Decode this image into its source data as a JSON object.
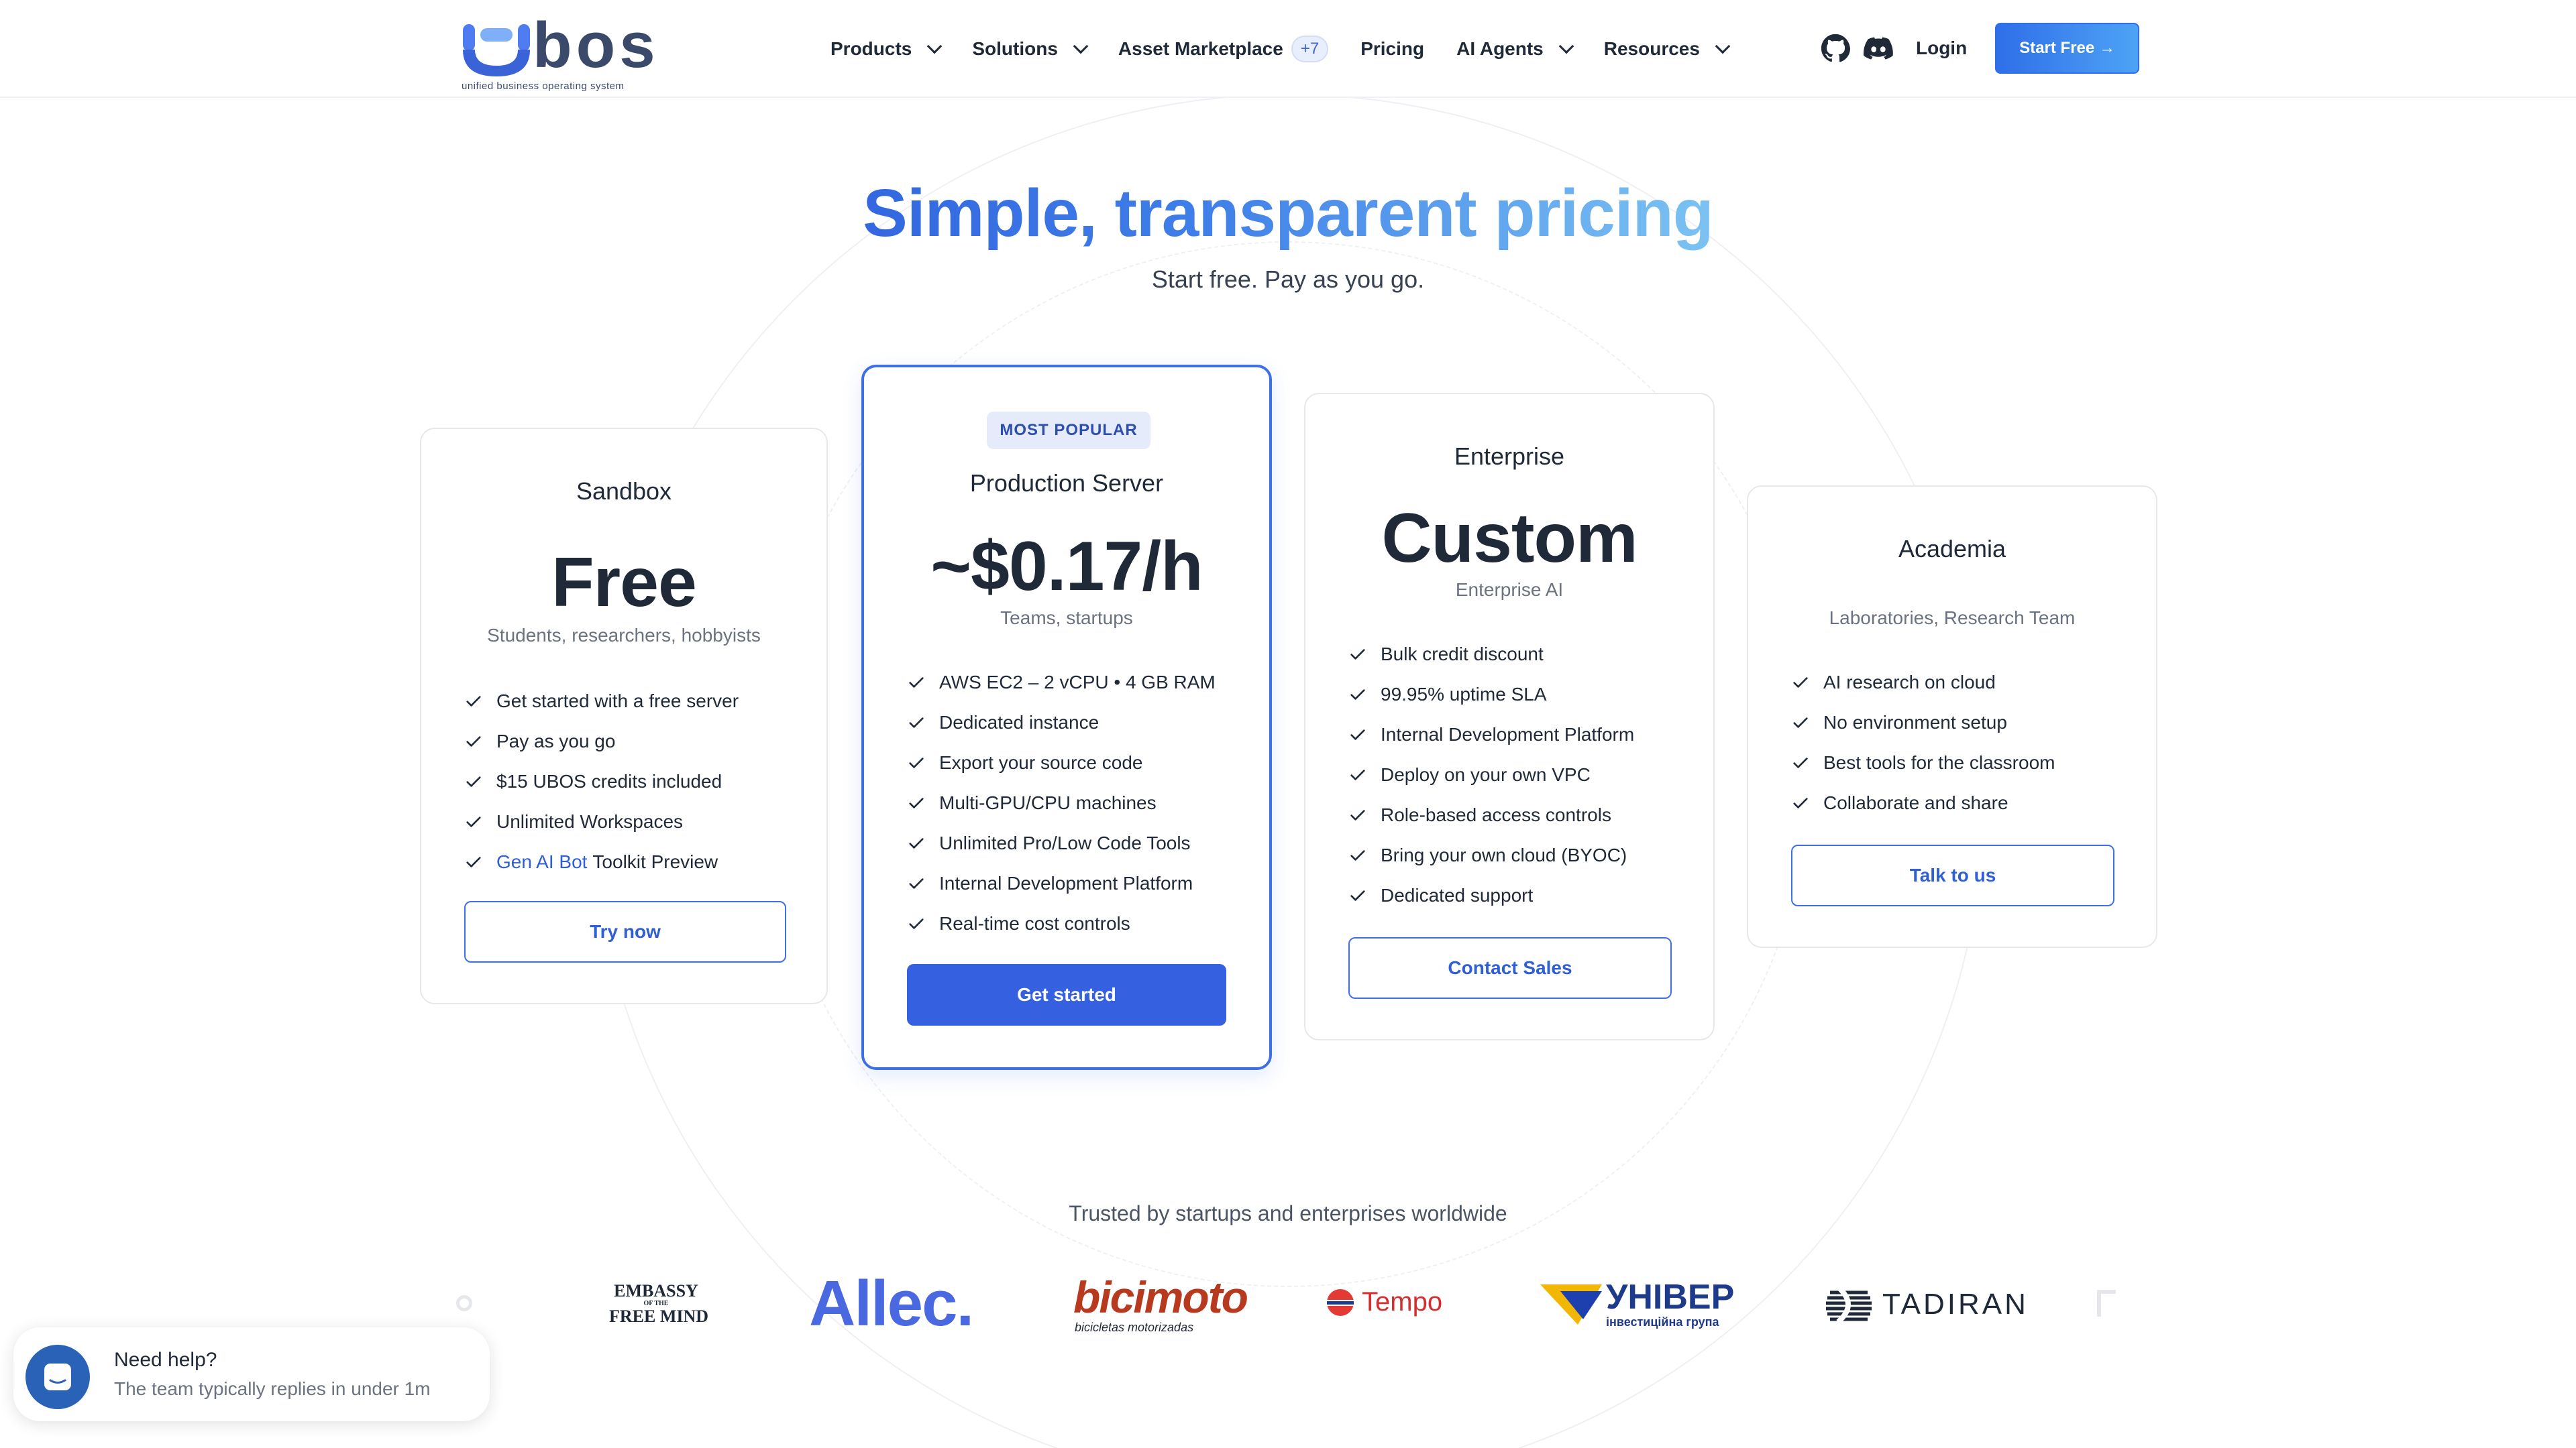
{
  "nav": {
    "logo_text": "ubos",
    "logo_tagline": "unified business operating system",
    "items": [
      {
        "label": "Products",
        "has_dropdown": true
      },
      {
        "label": "Solutions",
        "has_dropdown": true
      },
      {
        "label": "Asset Marketplace",
        "badge": "+7"
      },
      {
        "label": "Pricing"
      },
      {
        "label": "AI Agents",
        "has_dropdown": true
      },
      {
        "label": "Resources",
        "has_dropdown": true
      }
    ],
    "github_icon": "github-icon",
    "discord_icon": "discord-icon",
    "login": "Login",
    "cta": "Start Free →"
  },
  "hero": {
    "title": "Simple, transparent pricing",
    "subtitle": "Start free. Pay as you go."
  },
  "plans": [
    {
      "name": "Sandbox",
      "price": "Free",
      "audience": "Students, researchers, hobbyists",
      "features": [
        {
          "text": "Get started with a free server"
        },
        {
          "text": "Pay as you go"
        },
        {
          "text": "$15 UBOS credits included"
        },
        {
          "text": "Unlimited Workspaces"
        },
        {
          "link": "Gen AI Bot",
          "text": "Toolkit Preview"
        }
      ],
      "cta": "Try now"
    },
    {
      "badge": "MOST POPULAR",
      "name": "Production Server",
      "price": "~$0.17/h",
      "audience": "Teams, startups",
      "features": [
        {
          "text": "AWS EC2 – 2 vCPU • 4 GB RAM"
        },
        {
          "text": "Dedicated instance"
        },
        {
          "text": "Export your source code"
        },
        {
          "text": "Multi-GPU/CPU machines"
        },
        {
          "text": "Unlimited Pro/Low Code Tools"
        },
        {
          "text": "Internal Development Platform"
        },
        {
          "text": "Real-time cost controls"
        }
      ],
      "cta": "Get started"
    },
    {
      "name": "Enterprise",
      "price": "Custom",
      "audience": "Enterprise AI",
      "features": [
        {
          "text": "Bulk credit discount"
        },
        {
          "text": "99.95% uptime SLA"
        },
        {
          "text": "Internal Development Platform"
        },
        {
          "text": "Deploy on your own VPC"
        },
        {
          "text": "Role-based access controls"
        },
        {
          "text": "Bring your own cloud (BYOC)"
        },
        {
          "text": "Dedicated support"
        }
      ],
      "cta": "Contact Sales"
    },
    {
      "name": "Academia",
      "audience": "Laboratories, Research Team",
      "features": [
        {
          "text": "AI research on cloud"
        },
        {
          "text": "No environment setup"
        },
        {
          "text": "Best tools for the classroom"
        },
        {
          "text": "Collaborate and share"
        }
      ],
      "cta": "Talk to us"
    }
  ],
  "trusted": {
    "heading": "Trusted by startups and enterprises worldwide",
    "logos": {
      "embassy": {
        "line1": "EMBASSY",
        "line2": "OF THE",
        "line3": "FREE MIND"
      },
      "allec": "Allec.",
      "bicimoto": {
        "word": "bicimoto",
        "tagline": "bicicletas motorizadas"
      },
      "tempo": "Tempo",
      "univer": {
        "word": "УНІВЕР",
        "tagline": "інвестиційна група"
      },
      "tadiran": "TADIRAN"
    }
  },
  "chat": {
    "title": "Need help?",
    "subtitle": "The team typically replies in under 1m"
  },
  "colors": {
    "accent": "#3561e0",
    "accent_border": "#3f6fe5",
    "text": "#1f2937",
    "muted": "#6b7280"
  }
}
